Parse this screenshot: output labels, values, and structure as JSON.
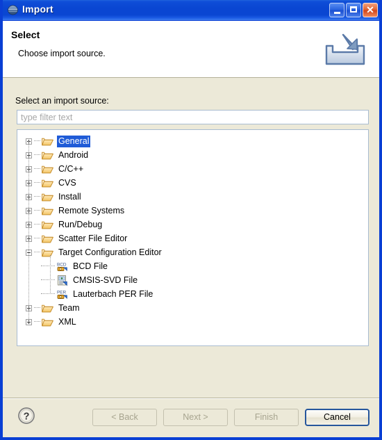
{
  "window": {
    "title": "Import",
    "icon": "eclipse-globe-icon",
    "controls": {
      "minimize": "minimize-button",
      "maximize": "maximize-button",
      "close": "close-button",
      "close_glyph": "✕"
    },
    "accent_color": "#0a46d2",
    "body_color": "#ece9d8"
  },
  "header": {
    "title": "Select",
    "subtitle": "Choose import source.",
    "icon": "import-wizard-icon"
  },
  "form": {
    "label": "Select an import source:",
    "filter": {
      "value": "",
      "placeholder": "type filter text"
    }
  },
  "tree": {
    "selection_color": "#1f5bd7",
    "nodes": [
      {
        "label": "General",
        "level": 0,
        "icon": "folder-icon",
        "state": "collapsed",
        "selected": true
      },
      {
        "label": "Android",
        "level": 0,
        "icon": "folder-icon",
        "state": "collapsed",
        "selected": false
      },
      {
        "label": "C/C++",
        "level": 0,
        "icon": "folder-icon",
        "state": "collapsed",
        "selected": false
      },
      {
        "label": "CVS",
        "level": 0,
        "icon": "folder-icon",
        "state": "collapsed",
        "selected": false
      },
      {
        "label": "Install",
        "level": 0,
        "icon": "folder-icon",
        "state": "collapsed",
        "selected": false
      },
      {
        "label": "Remote Systems",
        "level": 0,
        "icon": "folder-icon",
        "state": "collapsed",
        "selected": false
      },
      {
        "label": "Run/Debug",
        "level": 0,
        "icon": "folder-icon",
        "state": "collapsed",
        "selected": false
      },
      {
        "label": "Scatter File Editor",
        "level": 0,
        "icon": "folder-icon",
        "state": "collapsed",
        "selected": false
      },
      {
        "label": "Target Configuration Editor",
        "level": 0,
        "icon": "folder-icon",
        "state": "expanded",
        "selected": false
      },
      {
        "label": "BCD File",
        "level": 1,
        "icon": "bcd-file-icon",
        "state": "leaf",
        "selected": false
      },
      {
        "label": "CMSIS-SVD File",
        "level": 1,
        "icon": "cmsis-svd-file-icon",
        "state": "leaf",
        "selected": false
      },
      {
        "label": "Lauterbach PER File",
        "level": 1,
        "icon": "per-file-icon",
        "state": "leaf",
        "selected": false
      },
      {
        "label": "Team",
        "level": 0,
        "icon": "folder-icon",
        "state": "collapsed",
        "selected": false
      },
      {
        "label": "XML",
        "level": 0,
        "icon": "folder-icon",
        "state": "collapsed",
        "selected": false
      }
    ]
  },
  "footer": {
    "help": "help-button",
    "buttons": [
      {
        "label": "< Back",
        "name": "back-button",
        "enabled": false
      },
      {
        "label": "Next >",
        "name": "next-button",
        "enabled": false
      },
      {
        "label": "Finish",
        "name": "finish-button",
        "enabled": false
      },
      {
        "label": "Cancel",
        "name": "cancel-button",
        "enabled": true
      }
    ]
  }
}
